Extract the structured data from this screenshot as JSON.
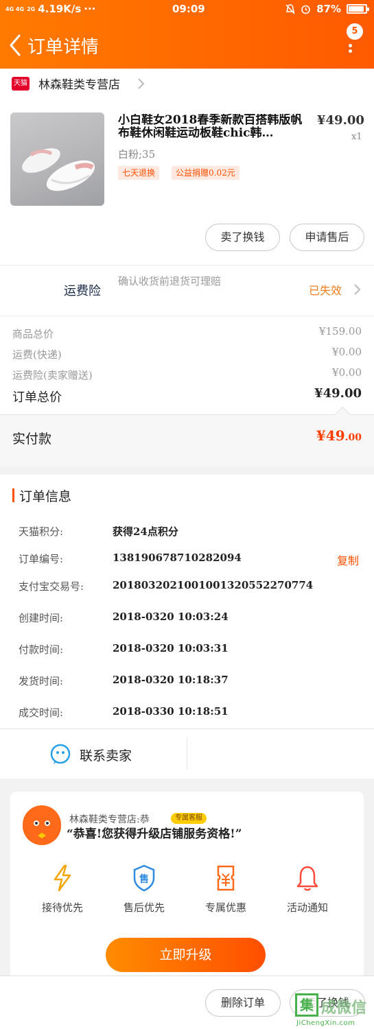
{
  "status_bar": {
    "network": "4G 4G",
    "signal": "2G",
    "speed": "4.19K/s",
    "extra": "···",
    "time": "09:09",
    "battery": "87%"
  },
  "header": {
    "title": "订单详情",
    "badge": "5",
    "color": "#ff6a00"
  },
  "shop": {
    "badge": "天猫",
    "name": "林森鞋类专营店"
  },
  "product": {
    "title": "小白鞋女2018春季新款百搭韩版帆布鞋休闲鞋运动板鞋chic韩…",
    "price": "¥49.00",
    "qty": "x1",
    "spec": "白粉;35",
    "tags": [
      "七天退换",
      "公益捐赠0.02元"
    ]
  },
  "actions": {
    "sell": "卖了换钱",
    "after_sale": "申请售后"
  },
  "insurance": {
    "label": "运费险",
    "desc": "确认收货前退货可理赔",
    "status": "已失效"
  },
  "fees": [
    {
      "label": "商品总价",
      "value": "¥159.00"
    },
    {
      "label": "运费(快递)",
      "value": "¥0.00"
    },
    {
      "label": "运费险(卖家赠送)",
      "value": "¥0.00"
    }
  ],
  "total": {
    "label": "订单总价",
    "value": "¥49.00"
  },
  "paid": {
    "label": "实付款",
    "value_main": "¥49",
    "value_cents": ".00",
    "color": "#ff3d00"
  },
  "order_info": {
    "title": "订单信息",
    "rows": [
      {
        "label": "天猫积分:",
        "value": "获得24点积分"
      },
      {
        "label": "订单编号:",
        "value": "138190678710282094"
      },
      {
        "label": "支付宝交易号:",
        "value": "2018032021001001320552270774"
      },
      {
        "label": "创建时间:",
        "value": "2018-0320 10:03:24"
      },
      {
        "label": "付款时间:",
        "value": "2018-0320 10:03:31"
      },
      {
        "label": "发货时间:",
        "value": "2018-0320 10:18:37"
      },
      {
        "label": "成交时间:",
        "value": "2018-0330 10:18:51"
      }
    ],
    "copy": "复制",
    "contact": "联系卖家"
  },
  "promo": {
    "shop": "林森鞋类专营店:恭",
    "vip_tag": "专属客服",
    "message": "“恭喜!您获得升级店铺服务资格!”",
    "perks": [
      {
        "icon": "lightning-icon",
        "label": "接待优先"
      },
      {
        "icon": "shield-sale-icon",
        "label": "售后优先"
      },
      {
        "icon": "coupon-icon",
        "label": "专属优惠"
      },
      {
        "icon": "bell-icon",
        "label": "活动通知"
      }
    ],
    "button": "立即升级"
  },
  "bottom": {
    "delete": "删除订单",
    "sell": "卖了换钱"
  },
  "watermark": {
    "box": "集",
    "text": "成微信",
    "url": "JiChengXin.com"
  }
}
